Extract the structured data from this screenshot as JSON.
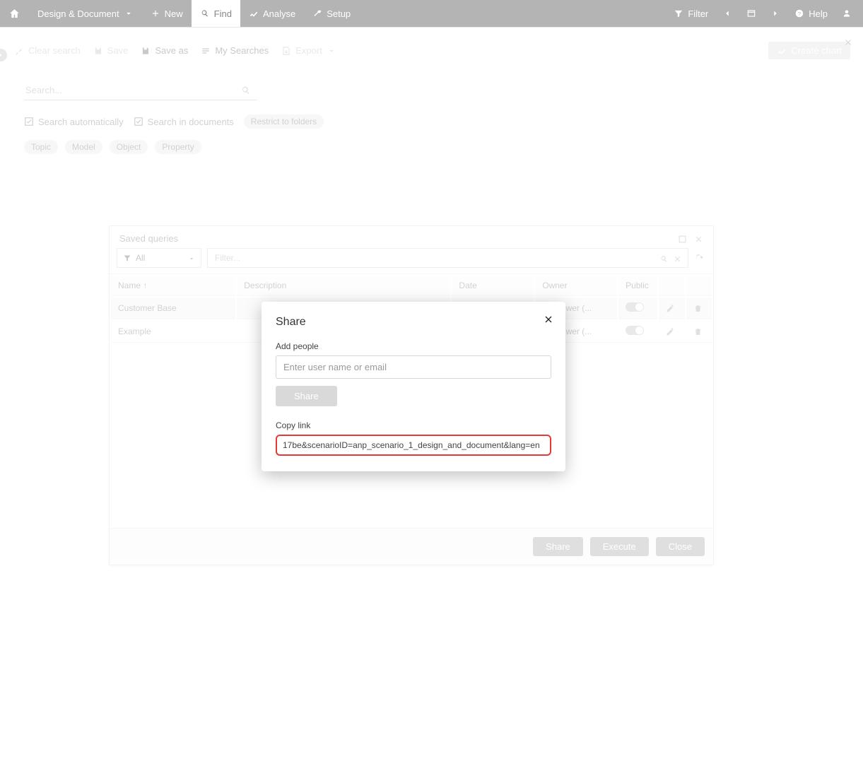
{
  "nav": {
    "dropdown": "Design & Document",
    "new": "New",
    "find": "Find",
    "analyse": "Analyse",
    "setup": "Setup",
    "filter": "Filter",
    "help": "Help"
  },
  "toolbar": {
    "clear": "Clear search",
    "save": "Save",
    "save_as": "Save as",
    "my_searches": "My Searches",
    "export": "Export",
    "create_chart": "Create chart"
  },
  "search": {
    "placeholder": "Search...",
    "auto": "Search automatically",
    "in_docs": "Search in documents",
    "restrict": "Restrict to folders",
    "chips": {
      "topic": "Topic",
      "model": "Model",
      "object": "Object",
      "property": "Property"
    }
  },
  "panel": {
    "title": "Saved queries",
    "all": "All",
    "filter_placeholder": "Filter...",
    "cols": {
      "name": "Name ↑",
      "desc": "Description",
      "date": "Date",
      "owner": "Owner",
      "public": "Public"
    },
    "rows": [
      {
        "name": "Customer Base",
        "desc": "",
        "date": "",
        "owner": "nis Power (..."
      },
      {
        "name": "Example",
        "desc": "",
        "date": "",
        "owner": "nis Power (..."
      }
    ],
    "footer": {
      "share": "Share",
      "execute": "Execute",
      "close": "Close"
    }
  },
  "modal": {
    "title": "Share",
    "add_people": "Add people",
    "add_people_placeholder": "Enter user name or email",
    "share_btn": "Share",
    "copy_link_label": "Copy link",
    "link": "17be&scenarioID=anp_scenario_1_design_and_document&lang=en"
  }
}
